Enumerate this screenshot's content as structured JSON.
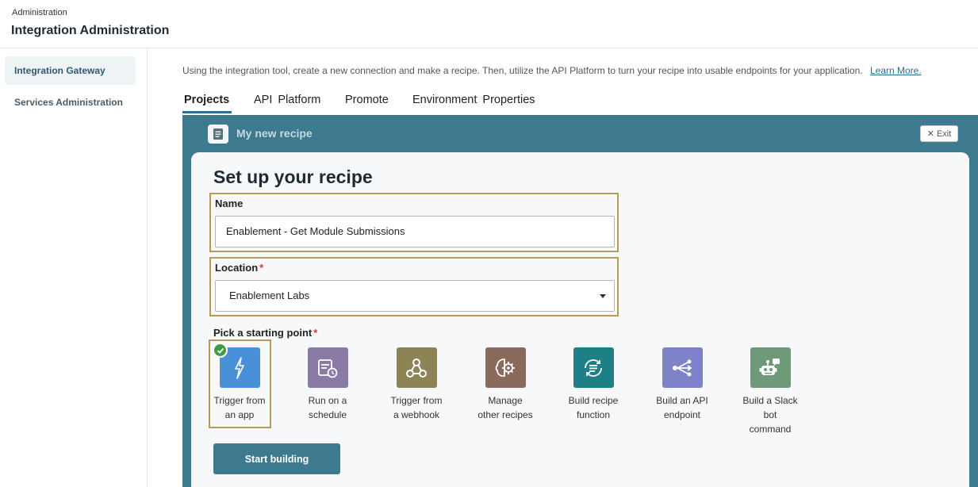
{
  "header": {
    "breadcrumb": "Administration",
    "title": "Integration Administration"
  },
  "sidebar": {
    "items": [
      {
        "label": "Integration Gateway",
        "active": true
      },
      {
        "label": "Services Administration",
        "active": false
      }
    ]
  },
  "intro": {
    "text": "Using the integration tool, create a new connection and make a recipe. Then, utilize the API Platform to turn your recipe into usable endpoints for your application.",
    "link": "Learn More."
  },
  "tabs": [
    {
      "label": "Projects",
      "active": true
    },
    {
      "label": "API Platform",
      "active": false
    },
    {
      "label": "Promote",
      "active": false
    },
    {
      "label": "Environment Properties",
      "active": false
    }
  ],
  "panel": {
    "title": "My new recipe",
    "exit_label": "Exit",
    "accent_color": "#3d7a8f"
  },
  "form": {
    "heading": "Set up your recipe",
    "name_label": "Name",
    "name_value": "Enablement - Get Module Submissions",
    "location_label": "Location",
    "location_value": "Enablement Labs",
    "required_marker": "*",
    "pick_label": "Pick a starting point",
    "start_button": "Start building"
  },
  "starting_points": [
    {
      "label_line1": "Trigger from",
      "label_line2": "an app",
      "label_line3": "",
      "icon": "lightning-icon",
      "color": "#4a90d9",
      "selected": true
    },
    {
      "label_line1": "Run on a",
      "label_line2": "schedule",
      "label_line3": "",
      "icon": "schedule-icon",
      "color": "#8a7aa6",
      "selected": false
    },
    {
      "label_line1": "Trigger from",
      "label_line2": "a webhook",
      "label_line3": "",
      "icon": "webhook-icon",
      "color": "#8c8456",
      "selected": false
    },
    {
      "label_line1": "Manage",
      "label_line2": "other recipes",
      "label_line3": "",
      "icon": "brain-gear-icon",
      "color": "#8a6a5a",
      "selected": false
    },
    {
      "label_line1": "Build recipe",
      "label_line2": "function",
      "label_line3": "",
      "icon": "function-icon",
      "color": "#1f7f86",
      "selected": false
    },
    {
      "label_line1": "Build an API",
      "label_line2": "endpoint",
      "label_line3": "",
      "icon": "api-endpoint-icon",
      "color": "#7d82c9",
      "selected": false
    },
    {
      "label_line1": "Build a Slack",
      "label_line2": "bot",
      "label_line3": "command",
      "icon": "slack-bot-icon",
      "color": "#6e9a7a",
      "selected": false
    }
  ]
}
